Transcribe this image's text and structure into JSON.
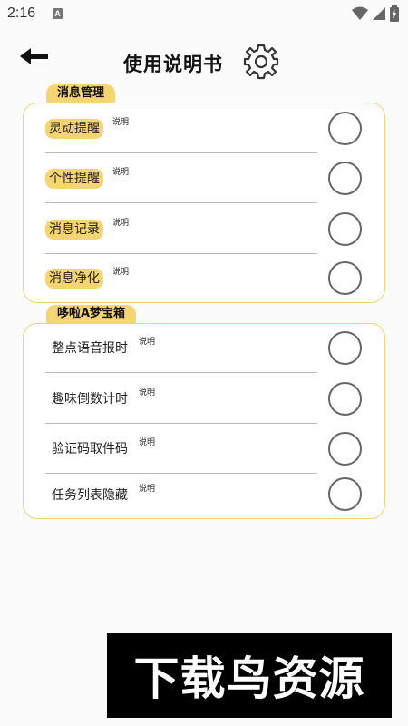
{
  "status_bar": {
    "time": "2:16",
    "notification_icon": "A"
  },
  "header": {
    "title": "使用说明书"
  },
  "sections": [
    {
      "tag": "消息管理",
      "rows": [
        {
          "label": "灵动提醒",
          "note": "说明"
        },
        {
          "label": "个性提醒",
          "note": "说明"
        },
        {
          "label": "消息记录",
          "note": "说明"
        },
        {
          "label": "消息净化",
          "note": "说明"
        }
      ]
    },
    {
      "tag": "哆啦A梦宝箱",
      "rows": [
        {
          "label": "整点语音报时",
          "note": "说明"
        },
        {
          "label": "趣味倒数计时",
          "note": "说明"
        },
        {
          "label": "验证码取件码",
          "note": "说明"
        },
        {
          "label": "任务列表隐藏",
          "note": "说明"
        }
      ]
    }
  ],
  "watermark": "下载鸟资源",
  "colors": {
    "accent": "#f5d56f",
    "card_border": "#f1d476",
    "toggle_border": "#666666"
  }
}
